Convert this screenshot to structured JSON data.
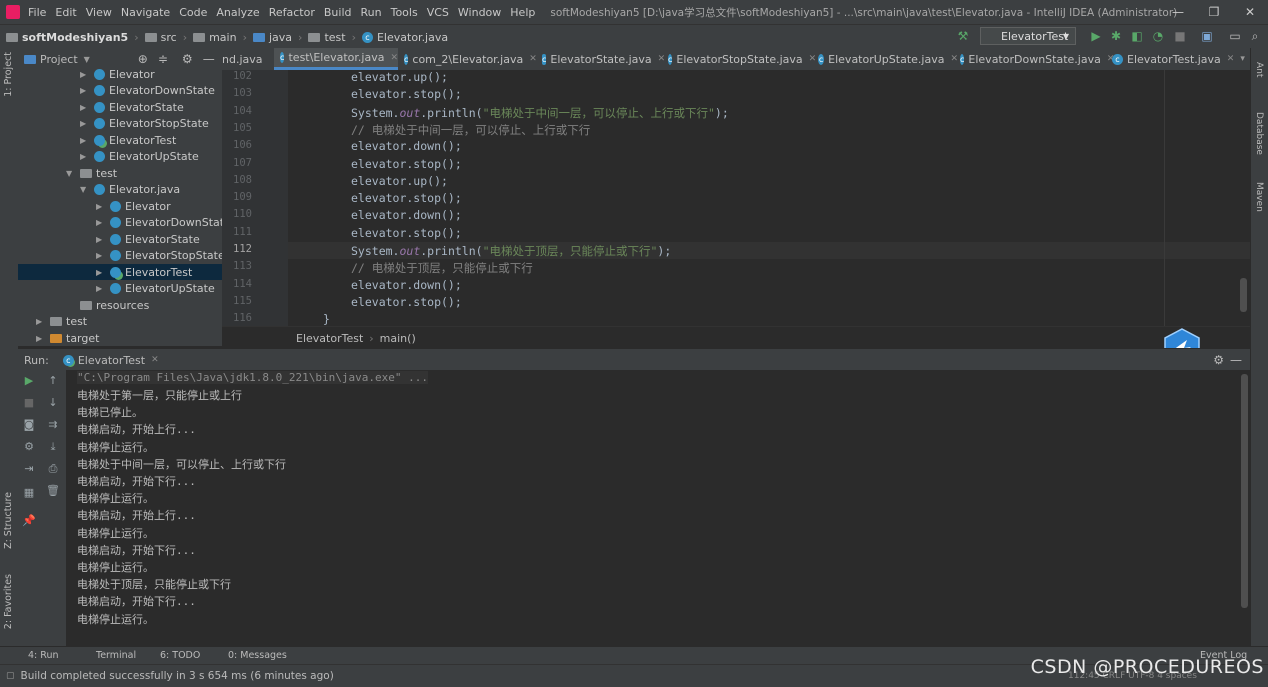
{
  "menubar": {
    "items": [
      "File",
      "Edit",
      "View",
      "Navigate",
      "Code",
      "Analyze",
      "Refactor",
      "Build",
      "Run",
      "Tools",
      "VCS",
      "Window",
      "Help"
    ],
    "title": "softModeshiyan5 [D:\\java学习总文件\\softModeshiyan5] - ...\\src\\main\\java\\test\\Elevator.java - IntelliJ IDEA (Administrator)",
    "win_controls": [
      "—",
      "❐",
      "✕"
    ]
  },
  "navbar": {
    "crumbs": [
      "softModeshiyan5",
      "src",
      "main",
      "java",
      "test",
      "Elevator.java"
    ],
    "run_config": "ElevatorTest"
  },
  "project": {
    "title": "Project",
    "tree": [
      {
        "label": "Elevator",
        "indent": 0,
        "kind": "class"
      },
      {
        "label": "ElevatorDownState",
        "indent": 0,
        "kind": "class"
      },
      {
        "label": "ElevatorState",
        "indent": 0,
        "kind": "class"
      },
      {
        "label": "ElevatorStopState",
        "indent": 0,
        "kind": "class"
      },
      {
        "label": "ElevatorTest",
        "indent": 0,
        "kind": "class"
      },
      {
        "label": "ElevatorUpState",
        "indent": 0,
        "kind": "class"
      },
      {
        "label": "test",
        "indent": -1,
        "kind": "package"
      },
      {
        "label": "Elevator.java",
        "indent": 0,
        "kind": "file"
      },
      {
        "label": "Elevator",
        "indent": 1,
        "kind": "class"
      },
      {
        "label": "ElevatorDownState",
        "indent": 1,
        "kind": "class"
      },
      {
        "label": "ElevatorState",
        "indent": 1,
        "kind": "class"
      },
      {
        "label": "ElevatorStopState",
        "indent": 1,
        "kind": "class"
      },
      {
        "label": "ElevatorTest",
        "indent": 1,
        "kind": "class",
        "selected": true
      },
      {
        "label": "ElevatorUpState",
        "indent": 1,
        "kind": "class"
      },
      {
        "label": "resources",
        "indent": -1,
        "kind": "folder"
      },
      {
        "label": "test",
        "indent": -2,
        "kind": "folder"
      },
      {
        "label": "target",
        "indent": -2,
        "kind": "folder-orange"
      }
    ]
  },
  "tabs": [
    {
      "label": "nd.java"
    },
    {
      "label": "test\\Elevator.java",
      "active": true
    },
    {
      "label": "com_2\\Elevator.java"
    },
    {
      "label": "ElevatorState.java"
    },
    {
      "label": "ElevatorStopState.java"
    },
    {
      "label": "ElevatorUpState.java"
    },
    {
      "label": "ElevatorDownState.java"
    },
    {
      "label": "ElevatorTest.java"
    }
  ],
  "editor": {
    "lines": [
      {
        "n": "102",
        "code": "elevator.up();"
      },
      {
        "n": "103",
        "code": "elevator.stop();"
      },
      {
        "n": "104",
        "code": "System.out.println(\"电梯处于中间一层，可以停止、上行或下行\");",
        "type": "println"
      },
      {
        "n": "105",
        "code": "// 电梯处于中间一层，可以停止、上行或下行",
        "type": "comment"
      },
      {
        "n": "106",
        "code": "elevator.down();"
      },
      {
        "n": "107",
        "code": "elevator.stop();"
      },
      {
        "n": "108",
        "code": "elevator.up();"
      },
      {
        "n": "109",
        "code": "elevator.stop();"
      },
      {
        "n": "110",
        "code": "elevator.down();"
      },
      {
        "n": "111",
        "code": "elevator.stop();"
      },
      {
        "n": "112",
        "code": "System.out.println(\"电梯处于顶层，只能停止或下行\");",
        "type": "println",
        "current": true
      },
      {
        "n": "113",
        "code": "// 电梯处于顶层，只能停止或下行",
        "type": "comment"
      },
      {
        "n": "114",
        "code": "elevator.down();"
      },
      {
        "n": "115",
        "code": "elevator.stop();"
      },
      {
        "n": "116",
        "code": "}",
        "type": "brace"
      }
    ],
    "breadcrumb": [
      "ElevatorTest",
      "main()"
    ]
  },
  "run": {
    "label": "Run:",
    "tab": "ElevatorTest",
    "command": "\"C:\\Program Files\\Java\\jdk1.8.0_221\\bin\\java.exe\" ...",
    "output": [
      "电梯处于第一层，只能停止或上行",
      "电梯已停止。",
      "电梯启动，开始上行...",
      "电梯停止运行。",
      "电梯处于中间一层，可以停止、上行或下行",
      "电梯启动，开始下行...",
      "电梯停止运行。",
      "电梯启动，开始上行...",
      "电梯停止运行。",
      "电梯启动，开始下行...",
      "电梯停止运行。",
      "电梯处于顶层，只能停止或下行",
      "电梯启动，开始下行...",
      "电梯停止运行。"
    ]
  },
  "bottom_tabs": [
    "4: Run",
    "Terminal",
    "6: TODO",
    "0: Messages"
  ],
  "status": {
    "message": "Build completed successfully in 3 s 654 ms (6 minutes ago)",
    "right": "112:45  CRLF  UTF-8  4 spaces",
    "event_log": "Event Log"
  },
  "side_left": [
    "1: Project",
    "Z: Structure",
    "2: Favorites"
  ],
  "side_right": [
    "Ant",
    "Database",
    "Maven"
  ],
  "watermark": "CSDN @PROCEDUREOS"
}
